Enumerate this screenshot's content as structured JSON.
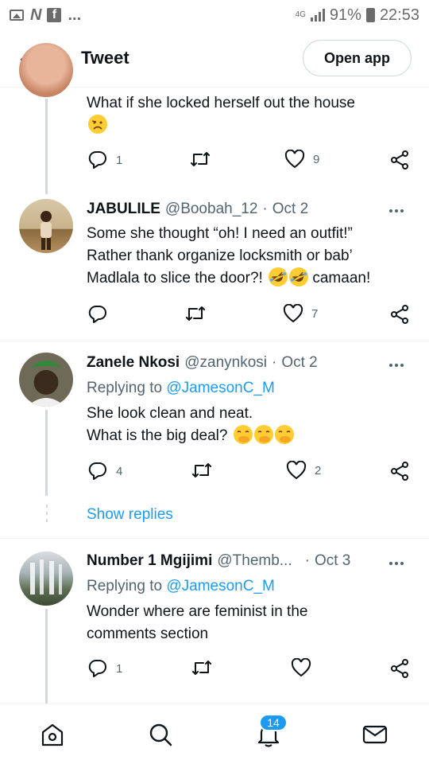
{
  "status_bar": {
    "notification_icons": [
      "image-icon",
      "n-logo-icon",
      "facebook-icon"
    ],
    "notif_n": "N",
    "notif_f": "f",
    "more": "...",
    "network": "4G",
    "battery": "91%",
    "time": "22:53"
  },
  "header": {
    "back_icon": "back-arrow-icon",
    "title": "Tweet",
    "open_app_label": "Open app"
  },
  "tweets": [
    {
      "text": "What if she locked herself out the house",
      "emoji": [
        "sad-face-emoji"
      ],
      "actions": {
        "reply_count": "1",
        "retweet_count": "",
        "like_count": "9"
      }
    },
    {
      "name": "JABULILE",
      "handle": "@Boobah_12",
      "dot": "·",
      "date": "Oct 2",
      "text_line1": "Some she thought “oh! I need an outfit!”",
      "text_line2": "Rather thank organize locksmith or bab’",
      "text_line3": "Madlala to slice the door?!",
      "text_line3_suffix": "camaan!",
      "emoji": [
        "rofl-emoji",
        "rofl-emoji"
      ],
      "actions": {
        "reply_count": "",
        "retweet_count": "",
        "like_count": "7"
      }
    },
    {
      "name": "Zanele Nkosi",
      "handle": "@zanynkosi",
      "dot": "·",
      "date": "Oct 2",
      "replying_prefix": "Replying to",
      "replying_to": "@JamesonC_M",
      "text_line1": "She look clean and neat.",
      "text_line2": "What is the big deal?",
      "emoji": [
        "hand-over-mouth-emoji",
        "hand-over-mouth-emoji",
        "hand-over-mouth-emoji"
      ],
      "actions": {
        "reply_count": "4",
        "retweet_count": "",
        "like_count": "2"
      }
    },
    {
      "name": "Number 1 Mgijimi",
      "handle": "@Themb...",
      "dot": "·",
      "date": "Oct 3",
      "replying_prefix": "Replying to",
      "replying_to": "@JamesonC_M",
      "text_line1": "Wonder where are feminist in the",
      "text_line2": "comments section",
      "actions": {
        "reply_count": "1",
        "retweet_count": "",
        "like_count": ""
      }
    }
  ],
  "show_replies_label": "Show replies",
  "bottom_nav": {
    "items": [
      "home-icon",
      "search-icon",
      "notifications-icon",
      "messages-icon"
    ],
    "notification_badge": "14"
  },
  "colors": {
    "accent": "#1d9bf0",
    "text": "#0f1419",
    "secondary_text": "#536471",
    "divider": "#eff3f4",
    "thread_line": "#cfd9de"
  }
}
